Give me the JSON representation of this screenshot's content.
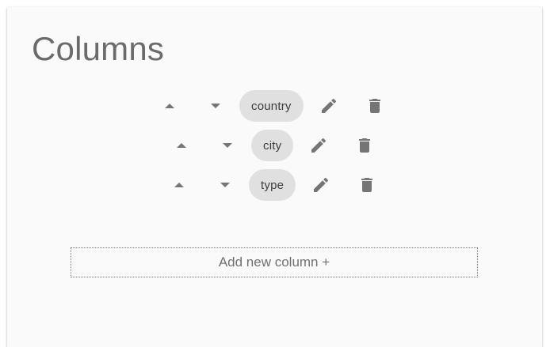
{
  "header": {
    "title": "Columns"
  },
  "columns": [
    {
      "label": "country"
    },
    {
      "label": "city"
    },
    {
      "label": "type"
    }
  ],
  "icons": {
    "move_up": "arrow-up-icon",
    "move_down": "arrow-down-icon",
    "edit": "pencil-icon",
    "delete": "trash-icon"
  },
  "actions": {
    "add_label": "Add new column +"
  },
  "colors": {
    "icon": "#757575",
    "chip_bg": "#e0e0e0",
    "card_bg": "#fafafa",
    "title": "#6b6b6b"
  }
}
